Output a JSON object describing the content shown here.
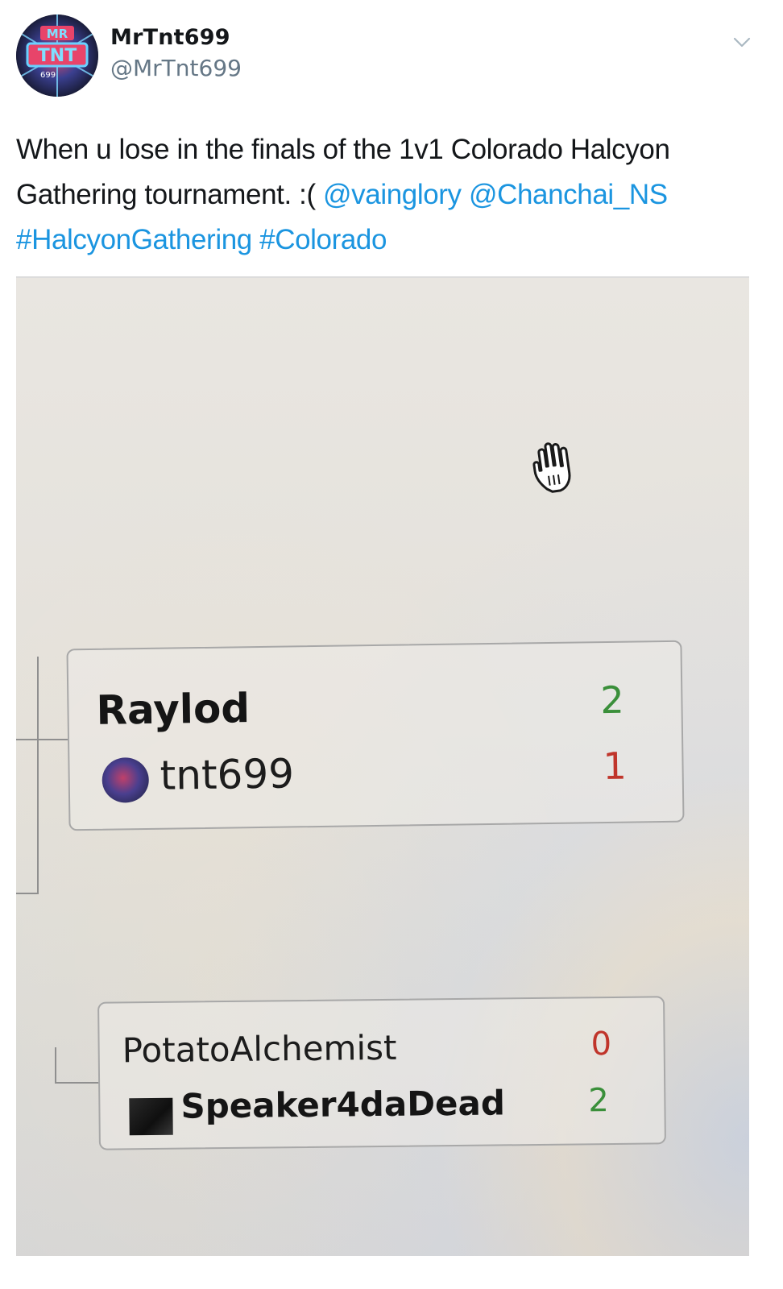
{
  "tweet": {
    "display_name": "MrTnt699",
    "handle": "@MrTnt699",
    "avatar_text": "MR TNT 699",
    "text_plain": "When u lose in the finals of the 1v1 Colorado Halcyon Gathering tournament. :(",
    "mentions": [
      "@vainglory",
      "@Chanchai_NS"
    ],
    "hashtags": [
      "#HalcyonGathering",
      "#Colorado"
    ],
    "menu_icon": "chevron-down-icon"
  },
  "photo": {
    "cursor_icon": "hand-cursor-icon",
    "matches": [
      {
        "player1": "Raylod",
        "score1": "2",
        "player2": "tnt699",
        "score2": "1"
      },
      {
        "player1": "PotatoAlchemist",
        "score1": "0",
        "player2": "Speaker4daDead",
        "score2": "2"
      }
    ],
    "colors": {
      "win": "#3a8f3a",
      "loss": "#c0352b"
    }
  }
}
